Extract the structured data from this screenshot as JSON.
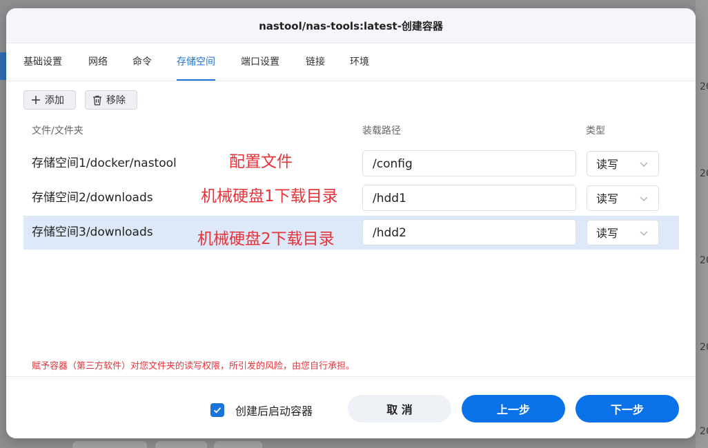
{
  "dialog": {
    "title": "nastool/nas-tools:latest-创建容器"
  },
  "tabs": [
    {
      "label": "基础设置"
    },
    {
      "label": "网络"
    },
    {
      "label": "命令"
    },
    {
      "label": "存储空间",
      "active": true
    },
    {
      "label": "端口设置"
    },
    {
      "label": "链接"
    },
    {
      "label": "环境"
    }
  ],
  "toolbar": {
    "add_label": "添加",
    "remove_label": "移除"
  },
  "columns": {
    "file": "文件/文件夹",
    "mount": "装载路径",
    "type": "类型"
  },
  "rows": [
    {
      "path": "存储空间1/docker/nastool",
      "annotation": "配置文件",
      "mount": "/config",
      "type": "读写",
      "selected": false
    },
    {
      "path": "存储空间2/downloads",
      "annotation": "机械硬盘1下载目录",
      "mount": "/hdd1",
      "type": "读写",
      "selected": false
    },
    {
      "path": "存储空间3/downloads",
      "annotation": "机械硬盘2下载目录",
      "mount": "/hdd2",
      "type": "读写",
      "selected": true
    }
  ],
  "warning": "赋予容器（第三方软件）对您文件夹的读写权限，所引发的风险，由您自行承担。",
  "footer": {
    "checkbox_label": "创建后启动容器",
    "checkbox_checked": true,
    "cancel_label": "取 消",
    "prev_label": "上一步",
    "next_label": "下一步"
  },
  "colors": {
    "accent": "#1a73d9",
    "primary_button": "#0a72e8",
    "annotation": "#e8323a",
    "selected_row": "#dde9f8"
  },
  "icons": {
    "add": "plus-icon",
    "remove": "trash-icon",
    "select": "chevron-down-icon",
    "checkbox": "check-icon"
  },
  "background": {
    "peek_text": "20"
  }
}
